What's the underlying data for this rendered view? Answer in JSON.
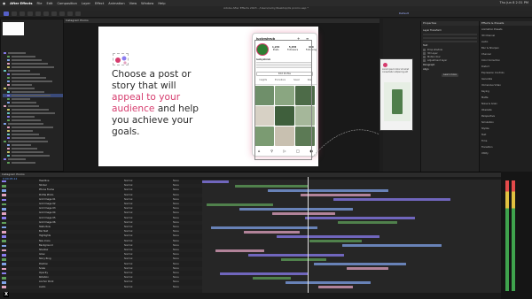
{
  "menubar": {
    "app_name": "After Effects",
    "items": [
      "File",
      "Edit",
      "Composition",
      "Layer",
      "Effect",
      "Animation",
      "View",
      "Window",
      "Help"
    ],
    "clock": "Thu Jun 8 2:31 PM"
  },
  "window_title": "Adobe After Effects 2023 - /Users/lucky/Desktop/IG promo.aep *",
  "workspace": {
    "label": "Default"
  },
  "composition": {
    "headline_part1": "Choose a post or story that will ",
    "headline_pink": "appeal to your audience",
    "headline_part2": " and help you achieve your goals."
  },
  "phone": {
    "handle": "luckyshrub",
    "stats": [
      {
        "value": "1,234",
        "label": "Posts"
      },
      {
        "value": "5,678",
        "label": "Followers"
      },
      {
        "value": "910",
        "label": "Following"
      }
    ],
    "bio_name": "luckyshrub",
    "edit_button": "Edit Profile",
    "highlights": [
      "Insights",
      "Promotions",
      "Saved",
      "New"
    ]
  },
  "preview_card": {
    "caption": "Lorem ipsum dolor sit amet consectetur adipiscing elit"
  },
  "properties": {
    "title": "Properties",
    "sections": [
      "Layer Transform",
      "Text",
      "Paragraph",
      "Align"
    ],
    "toggles": [
      "Drop shadow",
      "3D Layer",
      "Motion blur",
      "Adjustment layer"
    ],
    "action": "Learn more"
  },
  "effects_panel": {
    "title": "Effects & Presets",
    "items": [
      "Animation Presets",
      "3D Channel",
      "Audio",
      "Blur & Sharpen",
      "Channel",
      "Color Correction",
      "Distort",
      "Expression Controls",
      "Generate",
      "Immersive Video",
      "Keying",
      "Matte",
      "Noise & Grain",
      "Obsolete",
      "Perspective",
      "Simulation",
      "Stylize",
      "Text",
      "Time",
      "Transition",
      "Utility"
    ]
  },
  "timeline": {
    "comp_tab": "Instagram Promo",
    "timecode": "0;00;05;12",
    "layers": [
      "Headline",
      "Sticker",
      "Phone Frame",
      "Profile Photo",
      "Grid Image 01",
      "Grid Image 02",
      "Grid Image 03",
      "Grid Image 04",
      "Grid Image 05",
      "Grid Image 06",
      "Stats Row",
      "Bio Text",
      "Highlights",
      "Nav Icons",
      "Background",
      "Shadow",
      "Glow",
      "Story Ring",
      "Position",
      "Scale",
      "Opacity",
      "Rotation",
      "Anchor Point",
      "Audio"
    ],
    "mode": "Normal",
    "parent": "None"
  },
  "colors": {
    "accent": "#d63c6e",
    "label_purple": "#8a7cf0",
    "label_green": "#5fa05a",
    "label_blue": "#7fa2e8",
    "label_pink": "#e2a3c0"
  }
}
